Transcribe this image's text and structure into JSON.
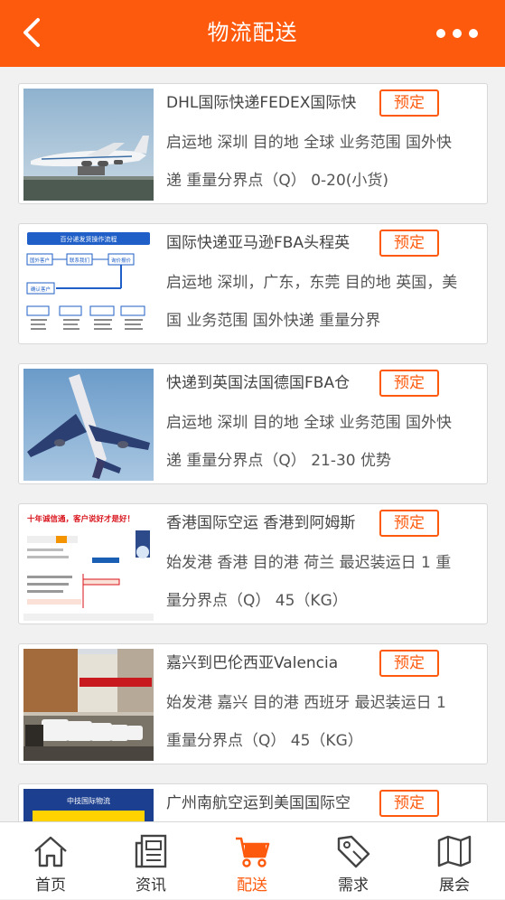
{
  "header": {
    "title": "物流配送"
  },
  "colors": {
    "accent": "#fe5a0e"
  },
  "items": [
    {
      "title": "DHL国际快递FEDEX国际快",
      "desc": "启运地 深圳 目的地 全球 业务范围 国外快递 重量分界点（Q） 0-20(小货)",
      "button": "预定",
      "thumb": "cargo-airplane-landing"
    },
    {
      "title": "国际快递亚马逊FBA头程英",
      "desc": "启运地 深圳，广东，东莞 目的地 英国，美国 业务范围 国外快递 重量分界",
      "button": "预定",
      "thumb": "process-flowchart",
      "thumb_text": {
        "heading": "百分递发货操作流程",
        "box1": "国外客户",
        "box2": "联系我们",
        "box3": "询价报价",
        "box4": "确认客户"
      }
    },
    {
      "title": "快递到英国法国德国FBA仓",
      "desc": "启运地 深圳 目的地 全球 业务范围 国外快递 重量分界点（Q） 21-30 优势",
      "button": "预定",
      "thumb": "airplane-takeoff"
    },
    {
      "title": "香港国际空运 香港到阿姆斯",
      "desc": "始发港 香港 目的港 荷兰 最迟装运日 1 重量分界点（Q） 45（KG）",
      "button": "预定",
      "thumb": "service-promo",
      "thumb_text": {
        "heading": "十年诚信通，客户说好才是好！"
      }
    },
    {
      "title": "嘉兴到巴伦西亚Valencia",
      "desc": "始发港 嘉兴 目的港 西班牙 最迟装运日 1 重量分界点（Q） 45（KG）",
      "button": "预定",
      "thumb": "delivery-vans-street"
    },
    {
      "title": "广州南航空运到美国国际空",
      "desc": "",
      "button": "预定",
      "thumb": "logistics-banner",
      "thumb_text": {
        "heading": "中技国际物流"
      }
    }
  ],
  "tabbar": [
    {
      "label": "首页",
      "icon": "home-icon",
      "active": false
    },
    {
      "label": "资讯",
      "icon": "news-icon",
      "active": false
    },
    {
      "label": "配送",
      "icon": "cart-icon",
      "active": true
    },
    {
      "label": "需求",
      "icon": "tag-icon",
      "active": false
    },
    {
      "label": "展会",
      "icon": "map-icon",
      "active": false
    }
  ]
}
